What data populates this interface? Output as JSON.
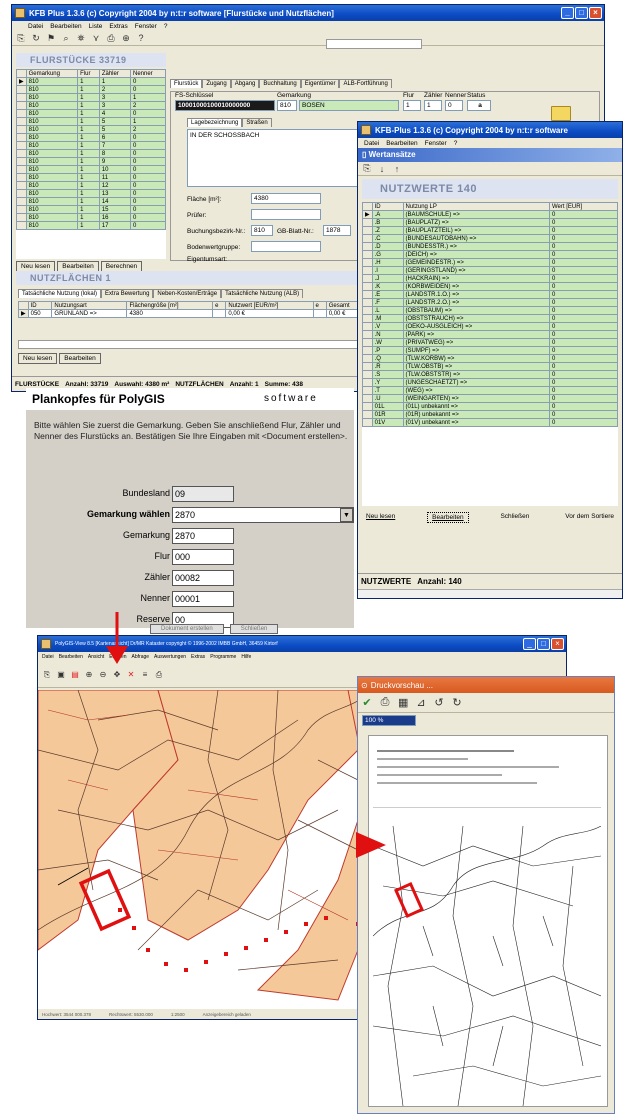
{
  "win1": {
    "title": "KFB Plus 1.3.6     (c) Copyright 2004 by n:t:r software   [Flurstücke und Nutzflächen]",
    "menu": [
      "Datei",
      "Bearbeiten",
      "Liste",
      "Extras",
      "Fenster",
      "?"
    ],
    "flur_header": "FLURSTÜCKE  33719",
    "flur_cols": [
      "Gemarkung",
      "Flur",
      "Zähler",
      "Nenner"
    ],
    "flur_rows": [
      [
        "810",
        "1",
        "1",
        "0"
      ],
      [
        "810",
        "1",
        "2",
        "0"
      ],
      [
        "810",
        "1",
        "3",
        "1"
      ],
      [
        "810",
        "1",
        "3",
        "2"
      ],
      [
        "810",
        "1",
        "4",
        "0"
      ],
      [
        "810",
        "1",
        "5",
        "1"
      ],
      [
        "810",
        "1",
        "5",
        "2"
      ],
      [
        "810",
        "1",
        "6",
        "0"
      ],
      [
        "810",
        "1",
        "7",
        "0"
      ],
      [
        "810",
        "1",
        "8",
        "0"
      ],
      [
        "810",
        "1",
        "9",
        "0"
      ],
      [
        "810",
        "1",
        "10",
        "0"
      ],
      [
        "810",
        "1",
        "11",
        "0"
      ],
      [
        "810",
        "1",
        "12",
        "0"
      ],
      [
        "810",
        "1",
        "13",
        "0"
      ],
      [
        "810",
        "1",
        "14",
        "0"
      ],
      [
        "810",
        "1",
        "15",
        "0"
      ],
      [
        "810",
        "1",
        "16",
        "0"
      ],
      [
        "810",
        "1",
        "17",
        "0"
      ]
    ],
    "tabs": [
      "Flurstück",
      "Zugang",
      "Abgang",
      "Buchhaltung",
      "Eigentümer",
      "ALB-Fortführung"
    ],
    "fs_key_label": "FS-Schlüssel",
    "fs_key_value": "10001000100010000000",
    "gemarkung_label": "Gemarkung",
    "gemarkung_value": "810",
    "gemarkung_name": "BOSEN",
    "flur_label": "Flur",
    "flur_value": "1",
    "zaehler_label": "Zähler",
    "zaehler_value": "1",
    "nenner_label": "Nenner",
    "nenner_value": "0",
    "status_label": "Status",
    "status_value": "a",
    "subtabs": [
      "Lagebezeichnung",
      "Straßen"
    ],
    "lage_text": "IN DER SCHOSSBACH",
    "flaeche_label": "Fläche [m²]:",
    "flaeche_value": "4380",
    "pruefer_label": "Prüfer:",
    "buchung_label": "Buchungsbezirk-Nr.:",
    "buchung_value": "810",
    "gb_label": "GB-Blatt-Nr.:",
    "gb_value": "1878",
    "bodenwert_label": "Bodenwertgruppe:",
    "eigentum_label": "Eigentumsart:",
    "btns1": [
      "Neu lesen",
      "Bearbeiten",
      "Berechnen"
    ],
    "nutz_header": "NUTZFLÄCHEN  1",
    "nutz_tabs": [
      "Tatsächliche Nutzung (lokal)",
      "Extra Bewertung",
      "Neben-Kosten/Erträge",
      "Tatsächliche Nutzung (ALB)"
    ],
    "nutz_cols": [
      "ID",
      "Nutzungsart",
      "Flächengröße [m²]",
      "e",
      "Nutzwert [EUR/m²]",
      "e",
      "Gesamt"
    ],
    "nutz_row": [
      "050",
      "GRÜNLAND =>",
      "4380",
      "",
      "0,00 €",
      "",
      "0,00 €"
    ],
    "btns2": [
      "Neu lesen",
      "Bearbeiten"
    ],
    "status": [
      "FLURSTÜCKE",
      "Anzahl: 33719",
      "Auswahl: 4380 m²",
      "NUTZFLÄCHEN",
      "Anzahl: 1",
      "Summe: 438"
    ]
  },
  "win2": {
    "title": "KFB-Plus 1.3.6     (c) Copyright 2004 by n:t:r software",
    "menu": [
      "Datei",
      "Bearbeiten",
      "Fenster",
      "?"
    ],
    "subtitle": "Wertansätze",
    "header": "NUTZWERTE  140",
    "cols": [
      "ID",
      "Nutzung LP",
      "Wert [EUR]"
    ],
    "rows": [
      [
        ".A",
        "(BAUMSCHULE) =>",
        "0"
      ],
      [
        ".B",
        "(BAUPLATZ) =>",
        "0"
      ],
      [
        ".Z",
        "(BAUPLATZTEIL) =>",
        "0"
      ],
      [
        ".C",
        "(BUNDESAUTOBAHN) =>",
        "0"
      ],
      [
        ".D",
        "(BUNDESSTR.) =>",
        "0"
      ],
      [
        ".G",
        "(DEICH) =>",
        "0"
      ],
      [
        ".H",
        "(GEMEINDESTR.) =>",
        "0"
      ],
      [
        ".I",
        "(GERINGSTLAND) =>",
        "0"
      ],
      [
        ".J",
        "(HACKRAIN) =>",
        "0"
      ],
      [
        ".K",
        "(KORBWEIDEN) =>",
        "0"
      ],
      [
        ".E",
        "(LANDSTR.1.O.) =>",
        "0"
      ],
      [
        ".F",
        "(LANDSTR.2.O.) =>",
        "0"
      ],
      [
        ".L",
        "(OBSTBAUM) =>",
        "0"
      ],
      [
        ".M",
        "(OBSTSTRAUCH) =>",
        "0"
      ],
      [
        ".V",
        "(OEKO-AUSGLEICH) =>",
        "0"
      ],
      [
        ".N",
        "(PARK) =>",
        "0"
      ],
      [
        ".W",
        "(PRIVATWEG) =>",
        "0"
      ],
      [
        ".P",
        "(SUMPF) =>",
        "0"
      ],
      [
        ".Q",
        "(TLW.KORBW) =>",
        "0"
      ],
      [
        ".R",
        "(TLW.OBSTB) =>",
        "0"
      ],
      [
        ".S",
        "(TLW.OBSTSTR) =>",
        "0"
      ],
      [
        ".Y",
        "(UNGESCHAETZT) =>",
        "0"
      ],
      [
        ".T",
        "(WEG) =>",
        "0"
      ],
      [
        ".U",
        "(WEINGARTEN) =>",
        "0"
      ],
      [
        "01L",
        "(01L) unbekannt =>",
        "0"
      ],
      [
        "01R",
        "(01R) unbekannt =>",
        "0"
      ],
      [
        "01V",
        "(01V) unbekannt =>",
        "0"
      ]
    ],
    "btns": [
      "Neu lesen",
      "Bearbeiten",
      "Schließen",
      "Vor dem Sortiere"
    ],
    "status": [
      "NUTZWERTE",
      "Anzahl: 140"
    ]
  },
  "dialog": {
    "title": "Plankopfes für PolyGIS",
    "brand": "software",
    "instructions": "Bitte wählen Sie zuerst die Gemarkung. Geben Sie anschließend Flur, Zähler und Nenner des Flurstücks an. Bestätigen Sie Ihre Eingaben mit <Document erstellen>.",
    "fields": [
      {
        "label": "Bundesland",
        "value": "09",
        "bold": false,
        "combo": false
      },
      {
        "label": "Gemarkung wählen",
        "value": "2870",
        "bold": true,
        "combo": true
      },
      {
        "label": "Gemarkung",
        "value": "2870",
        "bold": false,
        "combo": false
      },
      {
        "label": "Flur",
        "value": "000",
        "bold": false,
        "combo": false
      },
      {
        "label": "Zähler",
        "value": "00082",
        "bold": false,
        "combo": false
      },
      {
        "label": "Nenner",
        "value": "00001",
        "bold": false,
        "combo": false
      },
      {
        "label": "Reserve",
        "value": "00",
        "bold": false,
        "combo": false
      }
    ],
    "bottom_btns": [
      "Dokument erstellen",
      "Schließen"
    ]
  },
  "map": {
    "title": "PolyGIS-View 8.5  [Kartenansicht]  Dr/MR Kataster  copyright © 1996-2002 IMBB GmbH, 36459 Kirtorf",
    "menu": [
      "Datei",
      "Bearbeiten",
      "Ansicht",
      "Ebenen",
      "Abfrage",
      "Auswertungen",
      "Extras",
      "Programme",
      "Hilfe"
    ],
    "statusbar": [
      "Hochwert: 3544 000.378",
      "Rechtswert: 5530.000",
      "1:2500",
      "Anzeigebereich geladen"
    ]
  },
  "print": {
    "title": "Druckvorschau ...",
    "zoom": "100 %"
  },
  "colors": {
    "parcel": "#f5c89a",
    "line": "#c0392b",
    "highlight": "#e01010",
    "accent": "#0a3fa8",
    "green": "#c9e9b8"
  }
}
